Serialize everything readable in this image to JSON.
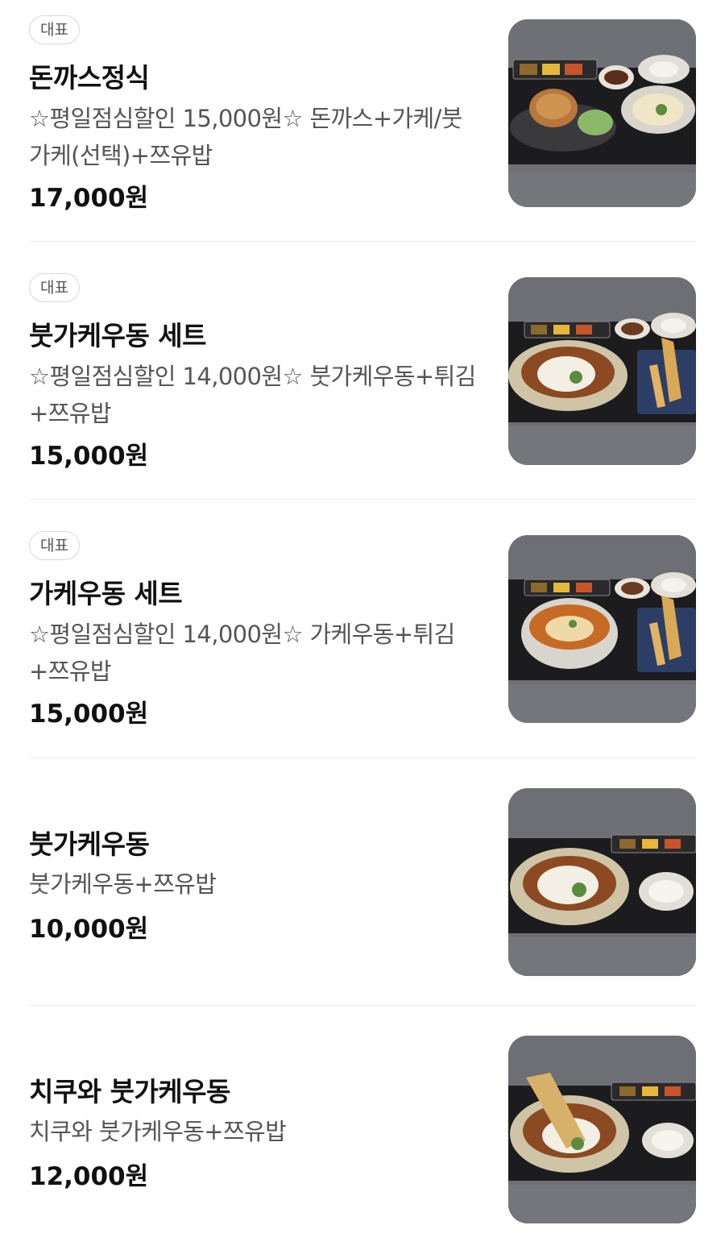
{
  "menu": {
    "items": [
      {
        "badge": "대표",
        "name": "돈까스정식",
        "description": "☆평일점심할인 15,000원☆ 돈까스+가케/붓가케(선택)+쯔유밥",
        "price": "17,000원",
        "image": "tonkatsu-set-photo"
      },
      {
        "badge": "대표",
        "name": "붓가케우동 세트",
        "description": "☆평일점심할인 14,000원☆ 붓가케우동+튀김+쯔유밥",
        "price": "15,000원",
        "image": "bukkake-udon-set-photo"
      },
      {
        "badge": "대표",
        "name": "가케우동 세트",
        "description": "☆평일점심할인 14,000원☆ 가케우동+튀김+쯔유밥",
        "price": "15,000원",
        "image": "kake-udon-set-photo"
      },
      {
        "name": "붓가케우동",
        "description": "붓가케우동+쯔유밥",
        "price": "10,000원",
        "image": "bukkake-udon-photo"
      },
      {
        "name": "치쿠와 붓가케우동",
        "description": "치쿠와 붓가케우동+쯔유밥",
        "price": "12,000원",
        "image": "chikuwa-bukkake-udon-photo"
      }
    ]
  }
}
